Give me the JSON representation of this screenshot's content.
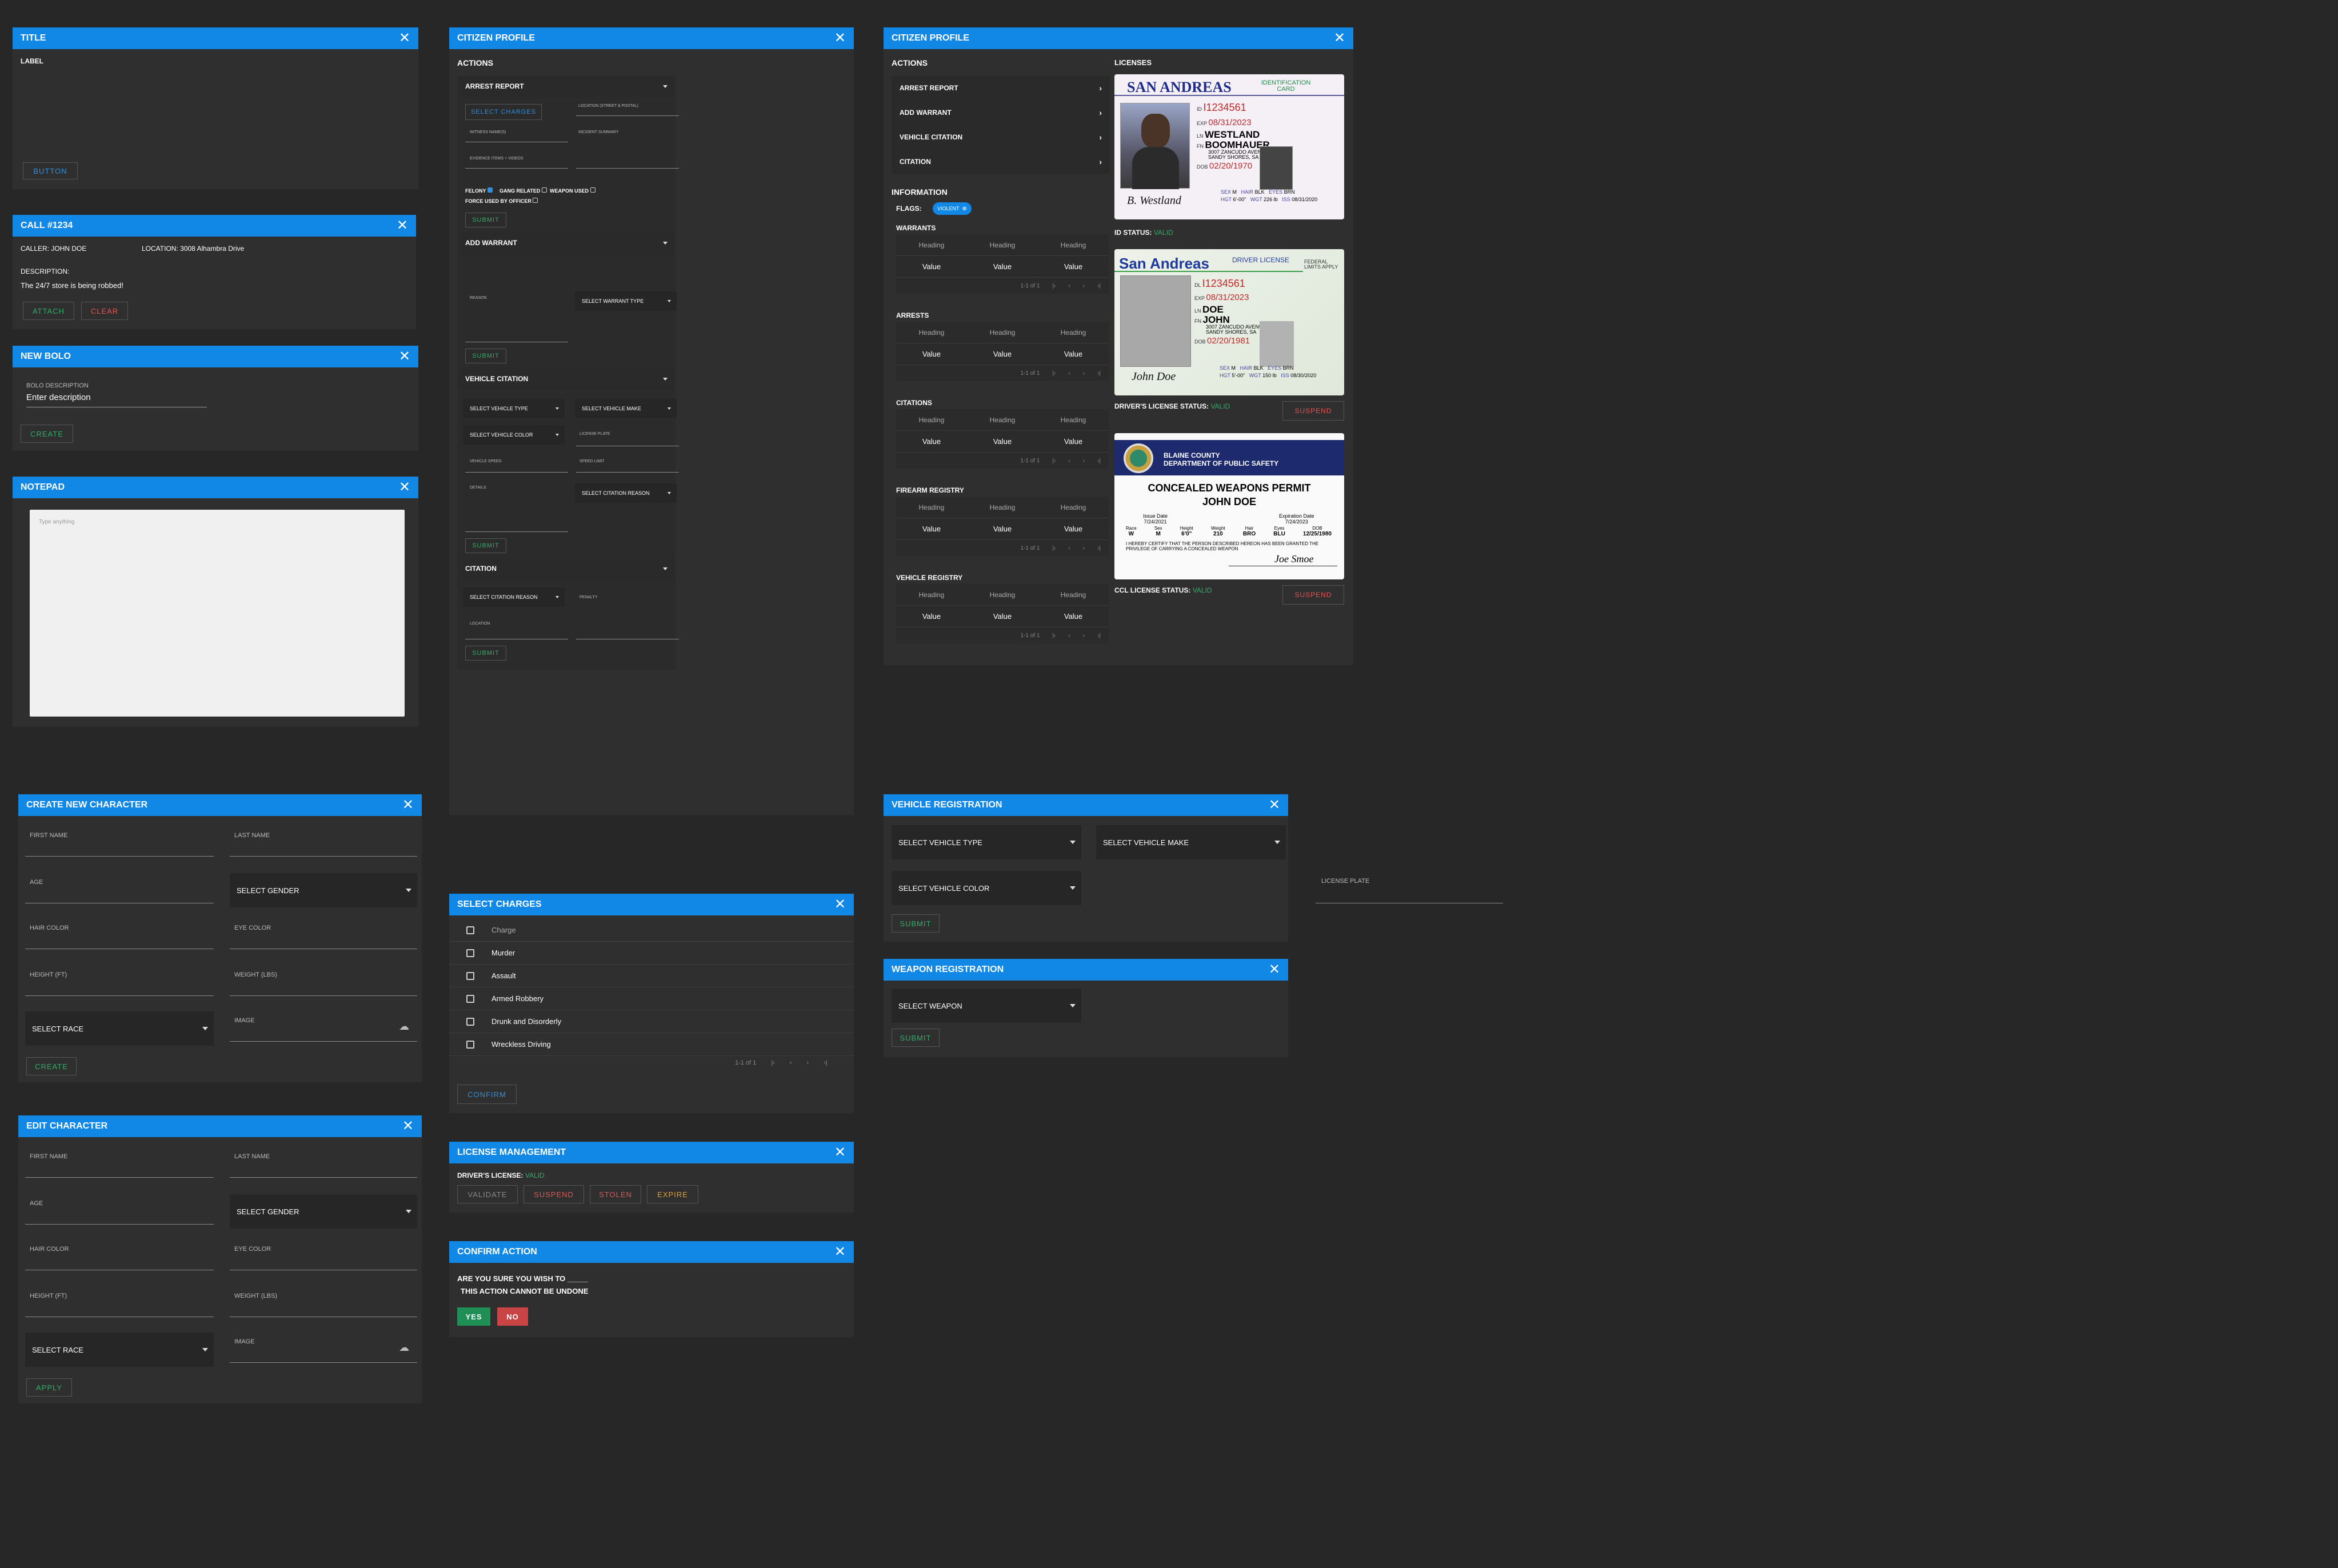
{
  "generic": {
    "title": "TITLE",
    "label": "LABEL",
    "button": "BUTTON"
  },
  "call": {
    "title": "CALL #1234",
    "caller": "CALLER: JOHN DOE",
    "location_label": "LOCATION:",
    "location": "3008 Alhambra Drive",
    "desc_label": "DESCRIPTION:",
    "desc": "The 24/7 store is being robbed!",
    "attach": "ATTACH",
    "clear": "CLEAR"
  },
  "bolo": {
    "title": "NEW BOLO",
    "field_label": "BOLO DESCRIPTION",
    "placeholder": "Enter description",
    "create": "CREATE"
  },
  "notepad": {
    "title": "NOTEPAD",
    "placeholder": "Type anything"
  },
  "cp1": {
    "title": "CITIZEN PROFILE",
    "actions": "ACTIONS",
    "arrest": "ARREST REPORT",
    "select_charges": "SELECT CHARGES",
    "location": "LOCATION (STREET & POSTAL)",
    "witness": "WITNESS NAME(S)",
    "summary": "INCIDENT SUMMARY",
    "evidence": "EVIDENCE ITEMS + VIDEOS",
    "felony": "FELONY",
    "gang": "GANG RELATED",
    "weapon": "WEAPON USED",
    "force": "FORCE USED BY OFFICER",
    "submit": "SUBMIT",
    "warrant": "ADD WARRANT",
    "reason": "REASON",
    "warrant_type": "SELECT WARRANT TYPE",
    "vcit": "VEHICLE CITATION",
    "vtype": "SELECT VEHICLE TYPE",
    "vmake": "SELECT VEHICLE MAKE",
    "vcolor": "SELECT VEHICLE COLOR",
    "plate": "LICENSE PLATE",
    "speed": "VEHICLE SPEED",
    "limit": "SPEED LIMIT",
    "details": "DETAILS",
    "cit_reason": "SELECT CITATION REASON",
    "citation": "CITATION",
    "penalty": "PENALTY",
    "location2": "LOCATION"
  },
  "cp2": {
    "title": "CITIZEN PROFILE",
    "actions": "ACTIONS",
    "items": [
      "ARREST REPORT",
      "ADD WARRANT",
      "VEHICLE CITATION",
      "CITATION"
    ],
    "information": "INFORMATION",
    "flags": "FLAGS:",
    "flag": "VIOLENT",
    "licenses": "LICENSES",
    "tables": [
      {
        "title": "WARRANTS"
      },
      {
        "title": "ARRESTS"
      },
      {
        "title": "CITATIONS"
      },
      {
        "title": "FIREARM REGISTRY"
      },
      {
        "title": "VEHICLE REGISTRY"
      }
    ],
    "heading": "Heading",
    "value": "Value",
    "pager": "1-1 of 1",
    "id_status": "ID STATUS:",
    "drv_status": "DRIVER'S LICENSE STATUS:",
    "ccl_status": "CCL LICENSE STATUS:",
    "valid": "VALID",
    "suspend": "SUSPEND"
  },
  "idcard": {
    "state": "SAN ANDREAS",
    "type": "IDENTIFICATION CARD",
    "id": "I1234561",
    "exp": "08/31/2023",
    "ln": "WESTLAND",
    "fn": "BOOMHAUER",
    "addr1": "3007 ZANCUDO AVENUE",
    "addr2": "SANDY SHORES, SA",
    "dob": "02/20/1970",
    "sex": "M",
    "hgt": "6'-00\"",
    "hair": "BLK",
    "wgt": "226 lb",
    "eyes": "BRN",
    "iss": "08/31/2020",
    "sig": "B. Westland"
  },
  "dlcard": {
    "state": "San Andreas",
    "type": "DRIVER LICENSE",
    "fed": "FEDERAL LIMITS APPLY",
    "id": "I1234561",
    "exp": "08/31/2023",
    "ln": "DOE",
    "fn": "JOHN",
    "addr1": "3007 ZANCUDO AVENUE",
    "addr2": "SANDY SHORES, SA",
    "dob": "02/20/1981",
    "sex": "M",
    "hgt": "5'-00\"",
    "hair": "BLK",
    "wgt": "150 lb",
    "eyes": "BRN",
    "iss": "08/30/2020",
    "sig": "John Doe"
  },
  "ccw": {
    "county": "BLAINE COUNTY",
    "dept": "DEPARTMENT OF PUBLIC SAFETY",
    "title": "CONCEALED WEAPONS PERMIT",
    "name": "JOHN DOE",
    "issue_label": "Issue Date",
    "issue": "7/24/2021",
    "exp_label": "Expiration Date",
    "exp": "7/24/2023",
    "cols": [
      "Race",
      "Sex",
      "Height",
      "Weight",
      "Hair",
      "Eyes",
      "DOB"
    ],
    "vals": [
      "W",
      "M",
      "6'0\"",
      "210",
      "BRO",
      "BLU",
      "12/25/1980"
    ],
    "cert": "I HEREBY CERTIFY THAT THE PERSON DESCRIBED HEREON HAS BEEN GRANTED THE PRIVILEGE OF CARRYING A CONCEALED WEAPON",
    "sig": "Joe Smoe"
  },
  "create": {
    "title": "CREATE NEW CHARACTER",
    "first": "FIRST NAME",
    "last": "LAST NAME",
    "age": "AGE",
    "gender": "SELECT GENDER",
    "hair": "HAIR COLOR",
    "eye": "EYE COLOR",
    "height": "HEIGHT (FT)",
    "weight": "WEIGHT (LBS)",
    "race": "SELECT RACE",
    "image": "IMAGE",
    "button": "CREATE"
  },
  "edit": {
    "title": "EDIT CHARACTER",
    "first": "FIRST NAME",
    "last": "LAST NAME",
    "age": "AGE",
    "gender": "SELECT GENDER",
    "hair": "HAIR COLOR",
    "eye": "EYE COLOR",
    "height": "HEIGHT (FT)",
    "weight": "WEIGHT (LBS)",
    "race": "SELECT RACE",
    "image": "IMAGE",
    "button": "APPLY"
  },
  "charges": {
    "title": "SELECT CHARGES",
    "header": "Charge",
    "items": [
      "Murder",
      "Assault",
      "Armed Robbery",
      "Drunk and Disorderly",
      "Wreckless Driving"
    ],
    "pager": "1-1 of 1",
    "confirm": "CONFIRM"
  },
  "license": {
    "title": "LICENSE MANAGEMENT",
    "label": "DRIVER'S LICENSE:",
    "status": "VALID",
    "validate": "VALIDATE",
    "suspend": "SUSPEND",
    "stolen": "STOLEN",
    "expire": "EXPIRE"
  },
  "confirm": {
    "title": "CONFIRM ACTION",
    "line1": "ARE YOU SURE YOU WISH TO _____",
    "line2": "THIS ACTION CANNOT BE UNDONE",
    "yes": "YES",
    "no": "NO"
  },
  "vreg": {
    "title": "VEHICLE REGISTRATION",
    "type": "SELECT VEHICLE TYPE",
    "make": "SELECT VEHICLE MAKE",
    "color": "SELECT VEHICLE COLOR",
    "plate": "LICENSE PLATE",
    "submit": "SUBMIT"
  },
  "wreg": {
    "title": "WEAPON REGISTRATION",
    "weapon": "SELECT WEAPON",
    "submit": "SUBMIT"
  }
}
